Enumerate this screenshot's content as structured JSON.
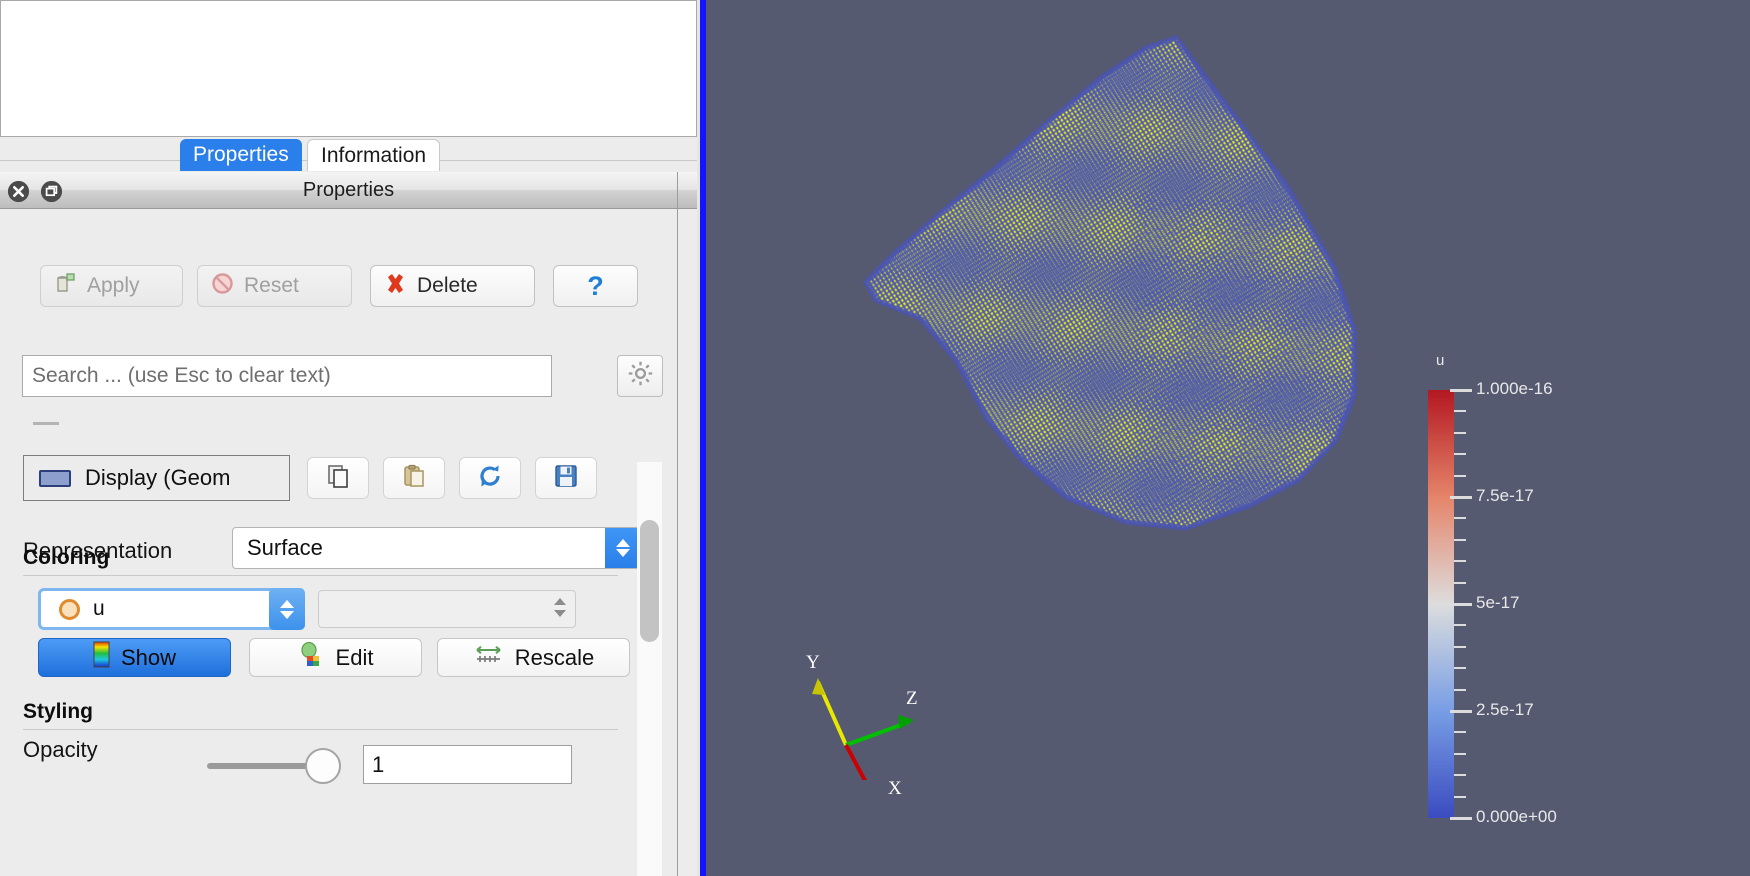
{
  "app": "ParaView",
  "pipeline_browser": {
    "name": "pipeline-browser",
    "items": []
  },
  "tabs": [
    {
      "label": "Properties",
      "selected": true
    },
    {
      "label": "Information",
      "selected": false
    }
  ],
  "panel": {
    "title": "Properties",
    "close_icon": "close-icon",
    "undock_icon": "undock-icon",
    "toolbar": [
      {
        "label": "Apply",
        "icon": "apply-icon",
        "enabled": false
      },
      {
        "label": "Reset",
        "icon": "reset-icon",
        "enabled": false
      },
      {
        "label": "Delete",
        "icon": "delete-icon",
        "enabled": true
      },
      {
        "label": "?",
        "icon": "help-icon",
        "enabled": true
      }
    ],
    "search": {
      "value": "",
      "placeholder": "Search ... (use Esc to clear text)",
      "gear_icon": "gear-icon"
    },
    "display_section": {
      "label": "Display (Geom",
      "buttons": [
        {
          "icon": "copy-icon"
        },
        {
          "icon": "paste-icon"
        },
        {
          "icon": "restore-defaults-icon"
        },
        {
          "icon": "save-as-defaults-icon"
        }
      ]
    },
    "representation": {
      "label": "Representation",
      "value": "Surface"
    },
    "coloring": {
      "heading": "Coloring",
      "array": "u",
      "array_icon": "point-data-icon",
      "component": "",
      "buttons": [
        {
          "label": "Show",
          "icon": "color-legend-icon",
          "active": true
        },
        {
          "label": "Edit",
          "icon": "edit-color-map-icon",
          "active": false
        },
        {
          "label": "Rescale",
          "icon": "rescale-range-icon",
          "active": false
        }
      ]
    },
    "styling": {
      "heading": "Styling",
      "opacity_label": "Opacity",
      "opacity_value": "1",
      "opacity_percent": 100
    }
  },
  "view": {
    "background_color": "#565a71",
    "mesh": {
      "surface_color": "#ffff00",
      "edge_color": "#4a55b4"
    },
    "orientation_axes": {
      "x": {
        "label": "X",
        "color": "#cc0000"
      },
      "y": {
        "label": "Y",
        "color": "#e8e800"
      },
      "z": {
        "label": "Z",
        "color": "#00c000"
      }
    },
    "color_legend": {
      "title": "u",
      "preset": "Cool to Warm",
      "min": "0.000e+00",
      "max": "1.000e-16",
      "labels": [
        "1.000e-16",
        "7.5e-17",
        "5e-17",
        "2.5e-17",
        "0.000e+00"
      ],
      "label_fractions": [
        0.0,
        0.25,
        0.5,
        0.75,
        1.0
      ]
    }
  },
  "chart_data": {
    "type": "heatmap",
    "title": "u",
    "colormap": "Cool to Warm",
    "vmin": 0.0,
    "vmax": 1e-16,
    "tick_labels": [
      "1.000e-16",
      "7.5e-17",
      "5e-17",
      "2.5e-17",
      "0.000e+00"
    ],
    "tick_values": [
      1e-16,
      7.5e-17,
      5e-17,
      2.5e-17,
      0.0
    ],
    "legend_position": "right",
    "description": "ParaView 3D render view of an unstructured mesh surface colored by scalar field u"
  }
}
